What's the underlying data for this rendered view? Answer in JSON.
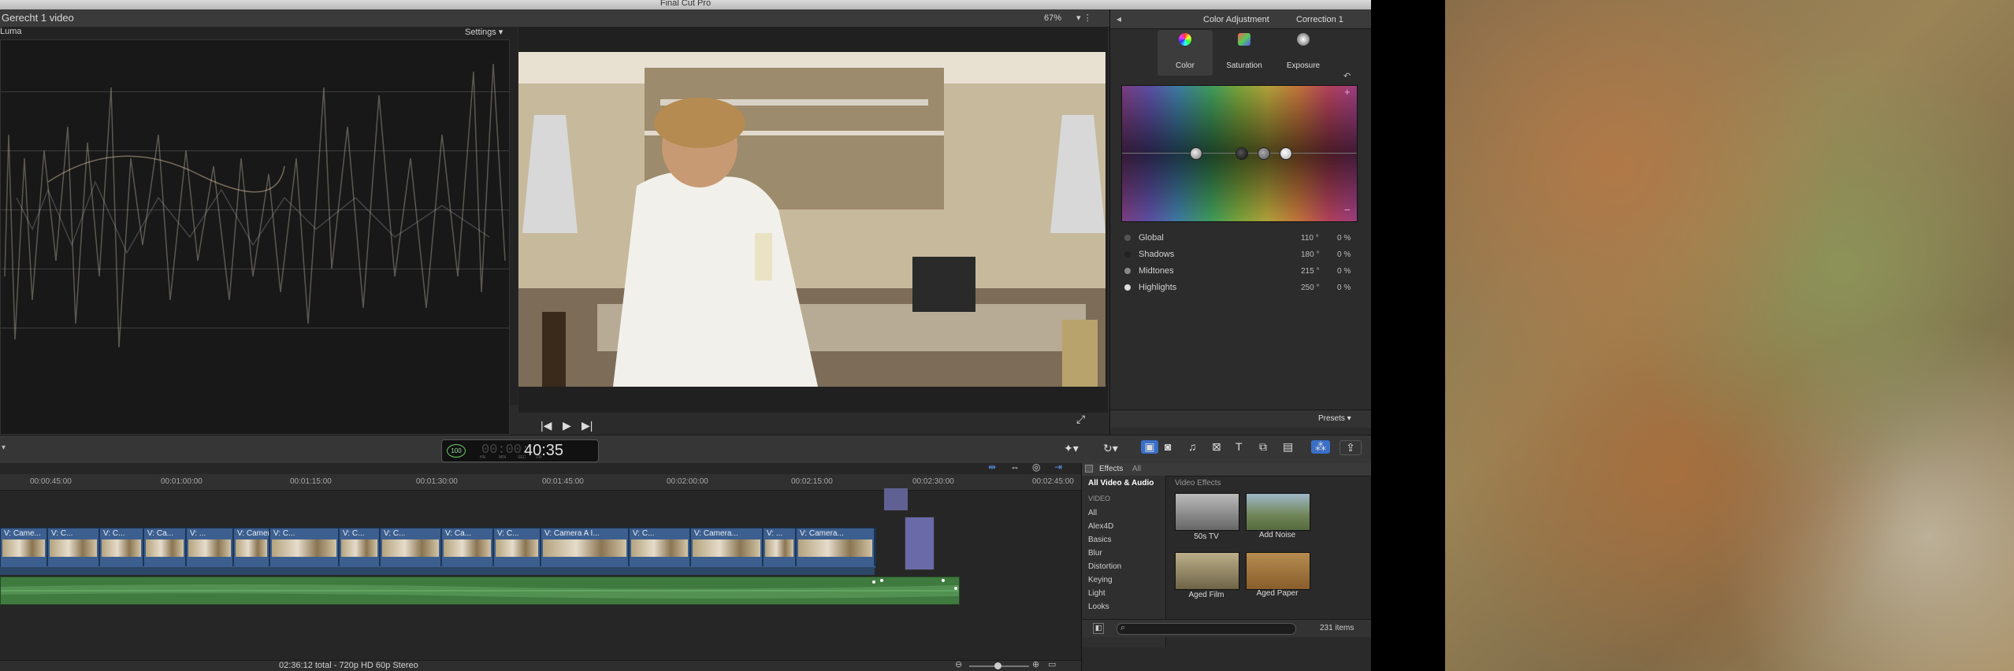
{
  "window": {
    "title": "Final Cut Pro",
    "project_title": "Gerecht 1 video",
    "scope_label": "Luma",
    "settings_label": "Settings",
    "zoom_level": "67%"
  },
  "inspector": {
    "title": "Color Adjustment",
    "correction": "Correction 1",
    "tabs": [
      {
        "label": "Color",
        "icon": "color-wheel-icon"
      },
      {
        "label": "Saturation",
        "icon": "saturation-icon"
      },
      {
        "label": "Exposure",
        "icon": "exposure-icon"
      }
    ],
    "rows": [
      {
        "label": "Global",
        "angle": "110 °",
        "percent": "0 %"
      },
      {
        "label": "Shadows",
        "angle": "180 °",
        "percent": "0 %"
      },
      {
        "label": "Midtones",
        "angle": "215 °",
        "percent": "0 %"
      },
      {
        "label": "Highlights",
        "angle": "250 °",
        "percent": "0 %"
      }
    ],
    "presets_label": "Presets"
  },
  "toolbar": {
    "timecode_small": "100",
    "timecode": "40:35",
    "timecode_prefix": "00:00:",
    "timecode_units": [
      "HR",
      "MIN",
      "SEC",
      "FR"
    ]
  },
  "timeline": {
    "ruler_ticks": [
      "00:00:45:00",
      "00:01:00:00",
      "00:01:15:00",
      "00:01:30:00",
      "00:01:45:00",
      "00:02:00:00",
      "00:02:15:00",
      "00:02:30:00",
      "00:02:45:00"
    ],
    "clip_labels": [
      "V: Came...",
      "V: C...",
      "V: C...",
      "V: Ca...",
      "V: ...",
      "V: Camera...",
      "V: C...",
      "V: C...",
      "V: C...",
      "V: Ca...",
      "V: C...",
      "V: Camera A I...",
      "V: C...",
      "V: Camera...",
      "V: ...",
      "V: Camera..."
    ],
    "status": "02:36:12 total - 720p HD 60p Stereo"
  },
  "effects": {
    "title": "Effects",
    "filter": "All",
    "section_header": "All Video & Audio",
    "video_header": "VIDEO",
    "categories": [
      "All",
      "Alex4D",
      "Basics",
      "Blur",
      "Distortion",
      "Keying",
      "Light",
      "Looks"
    ],
    "grid_header": "Video Effects",
    "tiles": [
      {
        "name": "50s TV",
        "color": "#8f8f8f"
      },
      {
        "name": "Add Noise",
        "color": "#7d8d6a"
      },
      {
        "name": "Aged Film",
        "color": "#8d8262"
      },
      {
        "name": "Aged Paper",
        "color": "#9a7440"
      }
    ],
    "count": "231 items"
  },
  "colors": {
    "accent": "#3a6fc7",
    "clip": "#3c5f8f",
    "audio": "#3f7a3f"
  }
}
